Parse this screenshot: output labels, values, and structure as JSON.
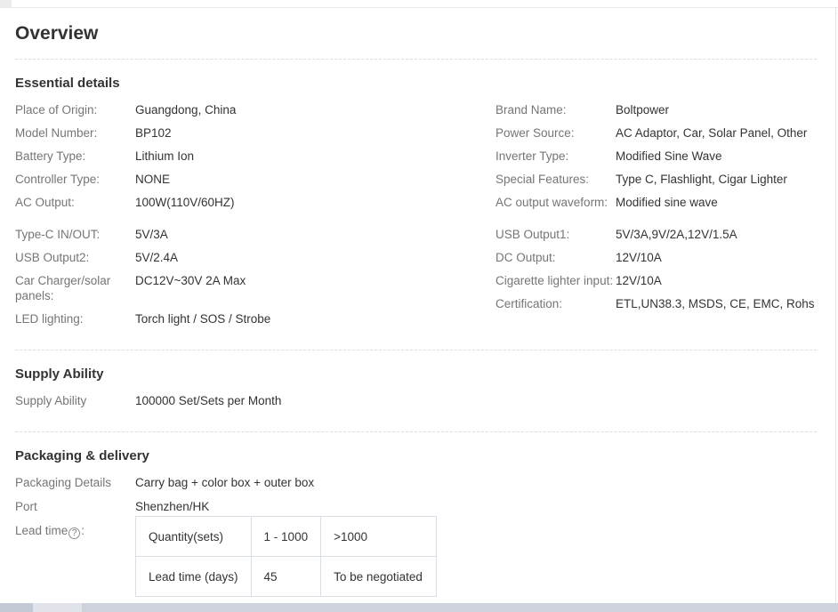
{
  "colors": {
    "label_text": "#757575",
    "value_text": "#333333",
    "heading_text": "#333333",
    "divider": "#dddddd",
    "table_border": "#d8dde6",
    "scrollbar_track": "#cdd2dd",
    "scrollbar_thumb": "#e0e4ea",
    "scrollbar_left_segment": "#c3c8d5"
  },
  "page": {
    "title": "Overview"
  },
  "essential": {
    "heading": "Essential details",
    "group1": {
      "left": [
        {
          "label": "Place of Origin:",
          "value": "Guangdong, China"
        },
        {
          "label": "Model Number:",
          "value": "BP102"
        },
        {
          "label": "Battery Type:",
          "value": "Lithium Ion"
        },
        {
          "label": "Controller Type:",
          "value": "NONE"
        },
        {
          "label": "AC Output:",
          "value": "100W(110V/60HZ)"
        }
      ],
      "right": [
        {
          "label": "Brand Name:",
          "value": "Boltpower"
        },
        {
          "label": "Power Source:",
          "value": "AC Adaptor, Car, Solar Panel, Other"
        },
        {
          "label": "Inverter Type:",
          "value": "Modified Sine Wave"
        },
        {
          "label": "Special Features:",
          "value": "Type C, Flashlight, Cigar Lighter"
        },
        {
          "label": "AC output waveform:",
          "value": "Modified sine wave"
        }
      ]
    },
    "group2": {
      "left": [
        {
          "label": "Type-C IN/OUT:",
          "value": "5V/3A"
        },
        {
          "label": "USB Output2:",
          "value": "5V/2.4A"
        },
        {
          "label": "Car Charger/solar panels:",
          "value": "DC12V~30V 2A Max"
        },
        {
          "label": "LED lighting:",
          "value": "Torch light / SOS / Strobe"
        }
      ],
      "right": [
        {
          "label": "USB Output1:",
          "value": "5V/3A,9V/2A,12V/1.5A"
        },
        {
          "label": "DC Output:",
          "value": "12V/10A"
        },
        {
          "label": "Cigarette lighter input:",
          "value": "12V/10A"
        },
        {
          "label": "Certification:",
          "value": "ETL,UN38.3, MSDS, CE, EMC, Rohs"
        }
      ]
    }
  },
  "supply": {
    "heading": "Supply Ability",
    "row": {
      "label": "Supply Ability",
      "value": "100000 Set/Sets per Month"
    }
  },
  "packaging": {
    "heading": "Packaging & delivery",
    "details": {
      "label": "Packaging Details",
      "value": "Carry bag + color box + outer box"
    },
    "port": {
      "label": "Port",
      "value": "Shenzhen/HK"
    },
    "lead_time": {
      "label": "Lead time",
      "colon": ":",
      "help_icon": "?"
    },
    "table": {
      "header": [
        "Quantity(sets)",
        "1 - 1000",
        ">1000"
      ],
      "row": [
        "Lead time (days)",
        "45",
        "To be negotiated"
      ]
    }
  }
}
